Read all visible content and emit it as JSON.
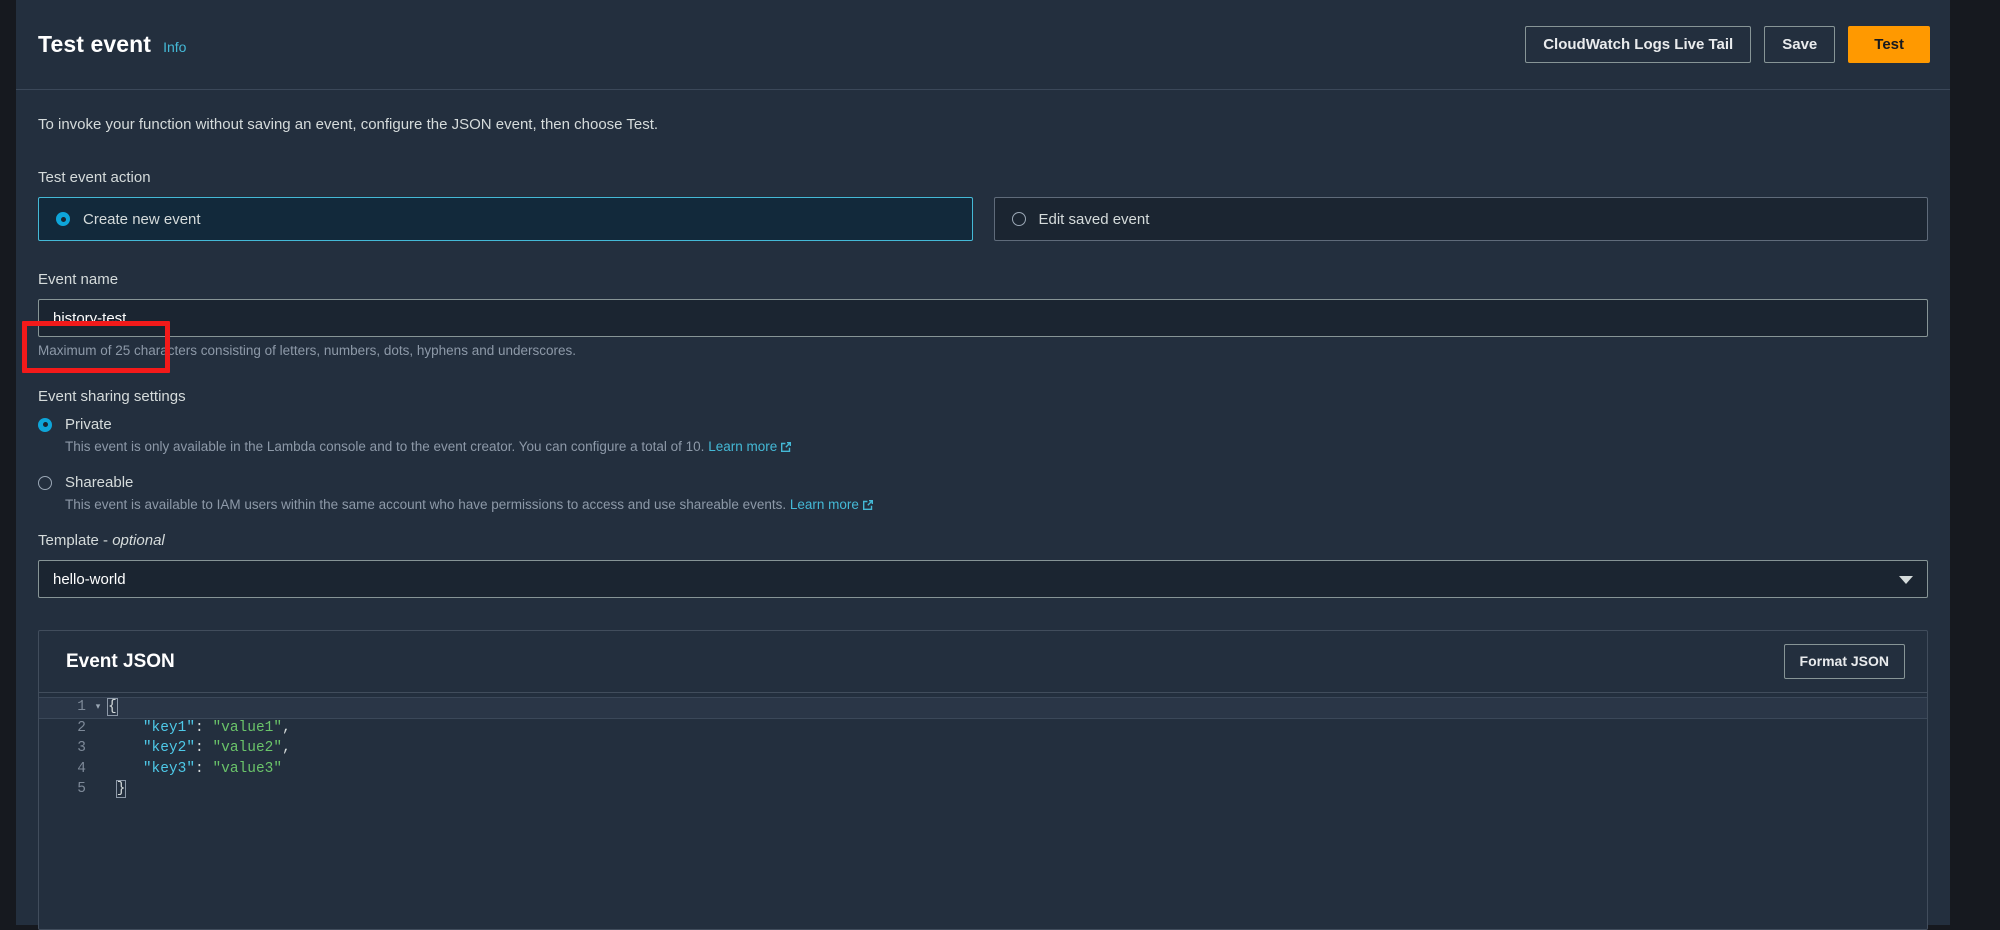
{
  "header": {
    "title": "Test event",
    "info_label": "Info",
    "buttons": [
      {
        "label": "CloudWatch Logs Live Tail",
        "style": "secondary"
      },
      {
        "label": "Save",
        "style": "secondary"
      },
      {
        "label": "Test",
        "style": "primary"
      }
    ]
  },
  "intro": "To invoke your function without saving an event, configure the JSON event, then choose Test.",
  "test_event_action": {
    "label": "Test event action",
    "options": [
      {
        "label": "Create new event",
        "selected": true
      },
      {
        "label": "Edit saved event",
        "selected": false
      }
    ]
  },
  "event_name": {
    "label": "Event name",
    "value": "history-test",
    "placeholder": "",
    "hint": "Maximum of 25 characters consisting of letters, numbers, dots, hyphens and underscores."
  },
  "event_sharing": {
    "label": "Event sharing settings",
    "options": [
      {
        "name": "Private",
        "selected": true,
        "description": "This event is only available in the Lambda console and to the event creator. You can configure a total of 10.",
        "learn_more": "Learn more"
      },
      {
        "name": "Shareable",
        "selected": false,
        "description": "This event is available to IAM users within the same account who have permissions to access and use shareable events.",
        "learn_more": "Learn more"
      }
    ]
  },
  "template": {
    "label": "Template - ",
    "label_optional": "optional",
    "value": "hello-world"
  },
  "event_json": {
    "title": "Event JSON",
    "format_button": "Format JSON",
    "lines": [
      {
        "num": "1",
        "fold": "▾",
        "active": true,
        "indent": "",
        "text_plain": "{"
      },
      {
        "num": "2",
        "fold": "",
        "active": false,
        "key": "\"key1\"",
        "sep": ": ",
        "val": "\"value1\"",
        "tail": ","
      },
      {
        "num": "3",
        "fold": "",
        "active": false,
        "key": "\"key2\"",
        "sep": ": ",
        "val": "\"value2\"",
        "tail": ","
      },
      {
        "num": "4",
        "fold": "",
        "active": false,
        "key": "\"key3\"",
        "sep": ": ",
        "val": "\"value3\"",
        "tail": ""
      },
      {
        "num": "5",
        "fold": "",
        "active": false,
        "indent": "",
        "text_plain": "}"
      }
    ]
  },
  "annotation": {
    "type": "highlight-rectangle",
    "color": "#f31a1a",
    "target": "event-name-input"
  },
  "colors": {
    "accent": "#ff9900",
    "link": "#44b9d6",
    "selected_tile_border": "#44b9d6",
    "panel_bg": "#232f3e",
    "input_bg": "#1b2531",
    "annotation": "#f31a1a"
  }
}
